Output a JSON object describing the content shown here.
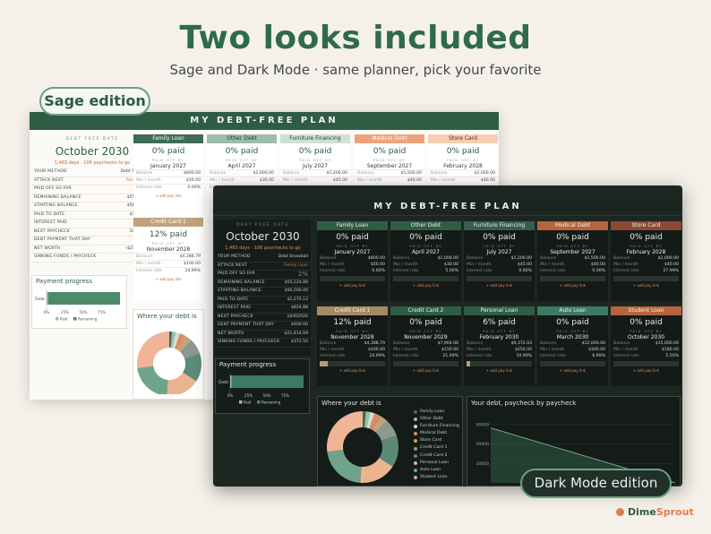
{
  "hero": {
    "title": "Two looks included",
    "subtitle": "Sage and Dark Mode · same planner, pick your favorite"
  },
  "badges": {
    "sage": "Sage edition",
    "dark": "Dark Mode edition"
  },
  "brand": {
    "part1": "Dime",
    "part2": "Sprout"
  },
  "planner_title": "MY DEBT-FREE PLAN",
  "summary": {
    "caption": "DEBT FREE DATE",
    "date": "October 2030",
    "days": "1,483 days · 106 paychecks to go",
    "rows": [
      {
        "k": "Your method",
        "v": "Debt Snowball"
      },
      {
        "k": "Attack next",
        "v": "Family Loan"
      },
      {
        "k": "Paid off so far",
        "v": "2%"
      },
      {
        "k": "Remaining balance",
        "v": "$55,224.88"
      },
      {
        "k": "Starting balance",
        "v": "$56,500.00"
      },
      {
        "k": "Paid to date",
        "v": "$1,275.12"
      },
      {
        "k": "Interest paid",
        "v": "$824.88"
      },
      {
        "k": "Next paycheck",
        "v": "10/9/2026"
      },
      {
        "k": "Debt payment that day",
        "v": "$400.00"
      },
      {
        "k": "Net worth",
        "v": "-$21,415.16"
      },
      {
        "k": "Sinking funds / paycheck",
        "v": "$372.50"
      }
    ],
    "dark_rows": [
      {
        "k": "Your method",
        "v": "Debt Snowball"
      },
      {
        "k": "Attack next",
        "v": "Family Loan"
      },
      {
        "k": "Paid off so far",
        "v": "2%"
      },
      {
        "k": "Remaining balance",
        "v": "$55,224.88"
      },
      {
        "k": "Starting balance",
        "v": "$56,500.00"
      },
      {
        "k": "Paid to date",
        "v": "$1,275.12"
      },
      {
        "k": "Interest paid",
        "v": "$824.88"
      },
      {
        "k": "Next paycheck",
        "v": "10/9/2026"
      },
      {
        "k": "Debt payment that day",
        "v": "$400.00"
      },
      {
        "k": "Net worth",
        "v": "-$21,414.69"
      },
      {
        "k": "Sinking funds / paycheck",
        "v": "$372.50"
      }
    ]
  },
  "labels": {
    "paid_off_by": "PAID OFF BY",
    "balance": "Balance",
    "min_month": "Min / month",
    "interest_rate": "Interest rate",
    "add_pay_link": "+ add pay link",
    "payment_progress": "Payment progress",
    "where_debt": "Where your debt is",
    "where_debt_sage": "Where your debt is",
    "paycheck_chart": "Your debt, paycheck by paycheck",
    "debt_axis": "Debt",
    "debt_axis_sage": "Debt",
    "paid": "Paid",
    "remaining": "Remaining",
    "ticks": [
      "0%",
      "25%",
      "50%",
      "75%"
    ]
  },
  "sage_cards": [
    {
      "name": "Family Loan",
      "pct": "0% paid",
      "date": "January 2027",
      "balance": "$800.00",
      "min": "$50.00",
      "rate": "0.00%",
      "color": "#3d6b53",
      "text": "#ffffff"
    },
    {
      "name": "Other Debt",
      "pct": "0% paid",
      "date": "April 2027",
      "balance": "$1,000.00",
      "min": "$30.00",
      "rate": "",
      "color": "#9fbcaa",
      "text": "#1f3a2c"
    },
    {
      "name": "Furniture Financing",
      "pct": "0% paid",
      "date": "July 2027",
      "balance": "$1,200.00",
      "min": "$45.00",
      "rate": "",
      "color": "#cfe0d4",
      "text": "#1f3a2c"
    },
    {
      "name": "Medical Debt",
      "pct": "0% paid",
      "date": "September 2027",
      "balance": "$1,500.00",
      "min": "$40.00",
      "rate": "",
      "color": "#eea27c",
      "text": "#ffffff"
    },
    {
      "name": "Store Card",
      "pct": "0% paid",
      "date": "February 2028",
      "balance": "$2,000.00",
      "min": "$40.00",
      "rate": "",
      "color": "#f4cdb4",
      "text": "#5a2f1c"
    },
    {
      "name": "Credit Card 1",
      "pct": "12% paid",
      "date": "November 2028",
      "balance": "$4,388.79",
      "min": "$100.00",
      "rate": "24.99%",
      "color": "#c2a27c",
      "text": "#ffffff"
    }
  ],
  "dark_cards": [
    {
      "name": "Family Loan",
      "pct": "0% paid",
      "date": "January 2027",
      "balance": "$800.00",
      "min": "$50.00",
      "rate": "0.00%",
      "color": "#2f5c45",
      "fill": 0
    },
    {
      "name": "Other Debt",
      "pct": "0% paid",
      "date": "April 2027",
      "balance": "$1,000.00",
      "min": "$30.00",
      "rate": "5.00%",
      "color": "#2f5c45",
      "fill": 0
    },
    {
      "name": "Furniture Financing",
      "pct": "0% paid",
      "date": "July 2027",
      "balance": "$1,200.00",
      "min": "$45.00",
      "rate": "0.00%",
      "color": "#365e4c",
      "fill": 0
    },
    {
      "name": "Medical Debt",
      "pct": "0% paid",
      "date": "September 2027",
      "balance": "$1,500.00",
      "min": "$40.00",
      "rate": "0.00%",
      "color": "#b5643c",
      "fill": 0
    },
    {
      "name": "Store Card",
      "pct": "0% paid",
      "date": "February 2028",
      "balance": "$2,000.00",
      "min": "$40.00",
      "rate": "27.99%",
      "color": "#8a4a34",
      "fill": 0
    },
    {
      "name": "Credit Card 1",
      "pct": "12% paid",
      "date": "November 2028",
      "balance": "$4,388.79",
      "min": "$100.00",
      "rate": "24.99%",
      "color": "#a58a66",
      "fill": 0.12
    },
    {
      "name": "Credit Card 2",
      "pct": "0% paid",
      "date": "November 2029",
      "balance": "$7,964.06",
      "min": "$150.00",
      "rate": "21.99%",
      "color": "#2f5c45",
      "fill": 0
    },
    {
      "name": "Personal Loan",
      "pct": "6% paid",
      "date": "February 2030",
      "balance": "$9,372.03",
      "min": "$250.00",
      "rate": "10.99%",
      "color": "#2f5c45",
      "fill": 0.06
    },
    {
      "name": "Auto Loan",
      "pct": "0% paid",
      "date": "March 2030",
      "balance": "$12,000.00",
      "min": "$300.00",
      "rate": "6.99%",
      "color": "#3d7a62",
      "fill": 0
    },
    {
      "name": "Student Loan",
      "pct": "0% paid",
      "date": "October 2030",
      "balance": "$15,000.00",
      "min": "$180.00",
      "rate": "5.50%",
      "color": "#b5643c",
      "fill": 0
    }
  ],
  "legend": [
    "Family Loan",
    "Other Debt",
    "Furniture Financing",
    "Medical Debt",
    "Store Card",
    "Credit Card 1",
    "Credit Card 2",
    "Personal Loan",
    "Auto Loan",
    "Student Loan"
  ],
  "legend_colors": [
    "#3d6b53",
    "#9fbcaa",
    "#cfe0d4",
    "#e08a5c",
    "#c2a27c",
    "#8a9a91",
    "#5c8a74",
    "#e9b48f",
    "#6fa48a",
    "#d9a88a"
  ],
  "donut_colors": [
    "#3d6b53",
    "#9fbcaa",
    "#cfe0d4",
    "#e08a5c",
    "#c2a27c",
    "#8a9a91",
    "#5c8a74",
    "#e9b48f",
    "#6fa48a",
    "#f0b497"
  ],
  "progress": {
    "paid_fraction": 0.02
  },
  "line_chart": {
    "yticks": [
      "60000",
      "40000",
      "20000"
    ],
    "xlim": [
      0,
      106
    ],
    "ylim": [
      0,
      70000
    ],
    "start": 56500,
    "end": 0
  }
}
